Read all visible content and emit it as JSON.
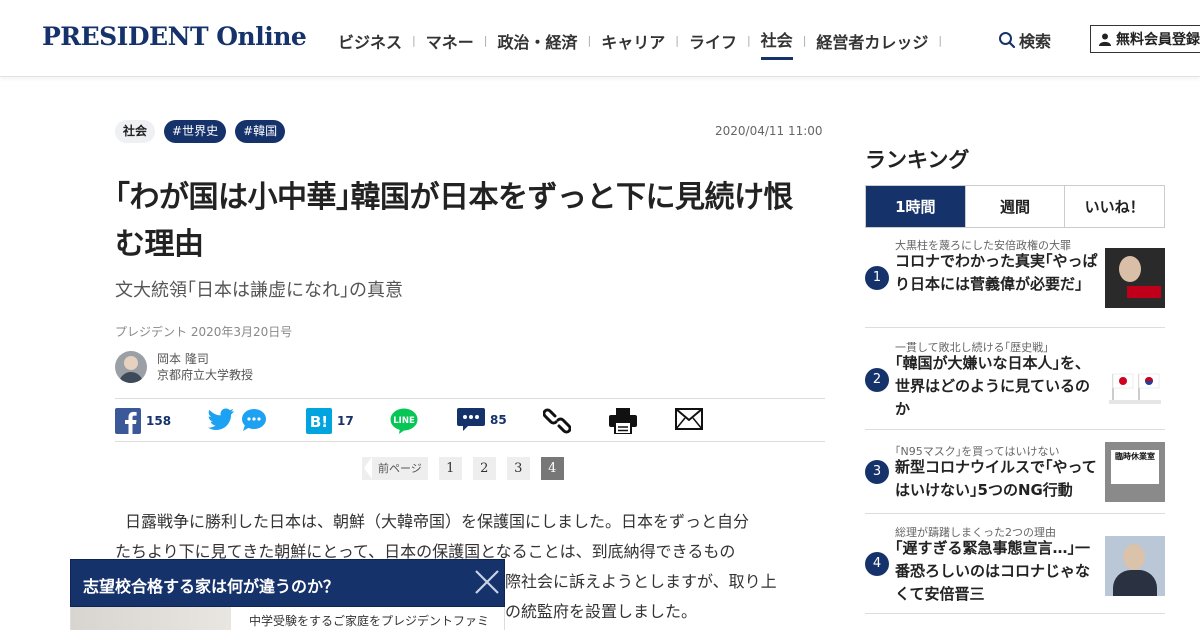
{
  "header": {
    "logo": "PRESIDENT Online",
    "nav": [
      {
        "label": "ビジネス"
      },
      {
        "label": "マネー"
      },
      {
        "label": "政治・経済"
      },
      {
        "label": "キャリア"
      },
      {
        "label": "ライフ"
      },
      {
        "label": "社会",
        "active": true
      },
      {
        "label": "経営者カレッジ"
      }
    ],
    "search_label": "検索",
    "signup_label": "無料会員登録"
  },
  "article": {
    "tags": [
      {
        "label": "社会"
      },
      {
        "label": "#世界史"
      },
      {
        "label": "#韓国"
      }
    ],
    "date": "2020/04/11 11:00",
    "title": "｢わが国は小中華｣韓国が日本をずっと下に見続け恨む理由",
    "subtitle": "文大統領｢日本は謙虚になれ｣の真意",
    "source": "プレジデント 2020年3月20日号",
    "author": {
      "name": "岡本 隆司",
      "affiliation": "京都府立大学教授"
    },
    "share": {
      "facebook_count": "158",
      "hatena_count": "17",
      "comment_count": "85"
    },
    "pager": {
      "prev_label": "前ページ",
      "pages": [
        "1",
        "2",
        "3",
        "4"
      ],
      "current": "4"
    },
    "body_lines": [
      "日露戦争に勝利した日本は、朝鮮（大韓帝国）を保護国にしました。日本をずっと自分",
      "たちより下に見てきた朝鮮にとって、日本の保護国となることは、到底納得できるもの",
      "際社会に訴えようとしますが、取り上",
      "の統監府を設置しました。"
    ]
  },
  "popup": {
    "title": "志望校合格する家は何が違うのか？",
    "description": "中学受験をするご家庭をプレジデントファミ"
  },
  "ranking": {
    "heading": "ランキング",
    "tabs": [
      {
        "label": "1時間",
        "active": true
      },
      {
        "label": "週間"
      },
      {
        "label": "いいね！"
      }
    ],
    "items": [
      {
        "rank": "1",
        "kicker": "大黒柱を蔑ろにした安倍政権の大罪",
        "title": "コロナでわかった真実｢やっぱり日本には菅義偉が必要だ｣"
      },
      {
        "rank": "2",
        "kicker": "一貫して敗北し続ける｢歴史戦｣",
        "title": "｢韓国が大嫌いな日本人｣を、世界はどのように見ているのか"
      },
      {
        "rank": "3",
        "kicker": "｢N95マスク｣を買ってはいけない",
        "title": "新型コロナウイルスで｢やってはいけない｣5つのNG行動",
        "thumb_text": "臨時休業室"
      },
      {
        "rank": "4",
        "kicker": "総理が躊躇しまくった2つの理由",
        "title": "｢遅すぎる緊急事態宣言…｣一番恐ろしいのはコロナじゃなくて安倍晋三"
      }
    ]
  },
  "colors": {
    "brand_navy": "#16326b",
    "facebook": "#3b5998",
    "twitter": "#1da1f2",
    "hatena": "#00a4de",
    "line": "#06c755"
  }
}
